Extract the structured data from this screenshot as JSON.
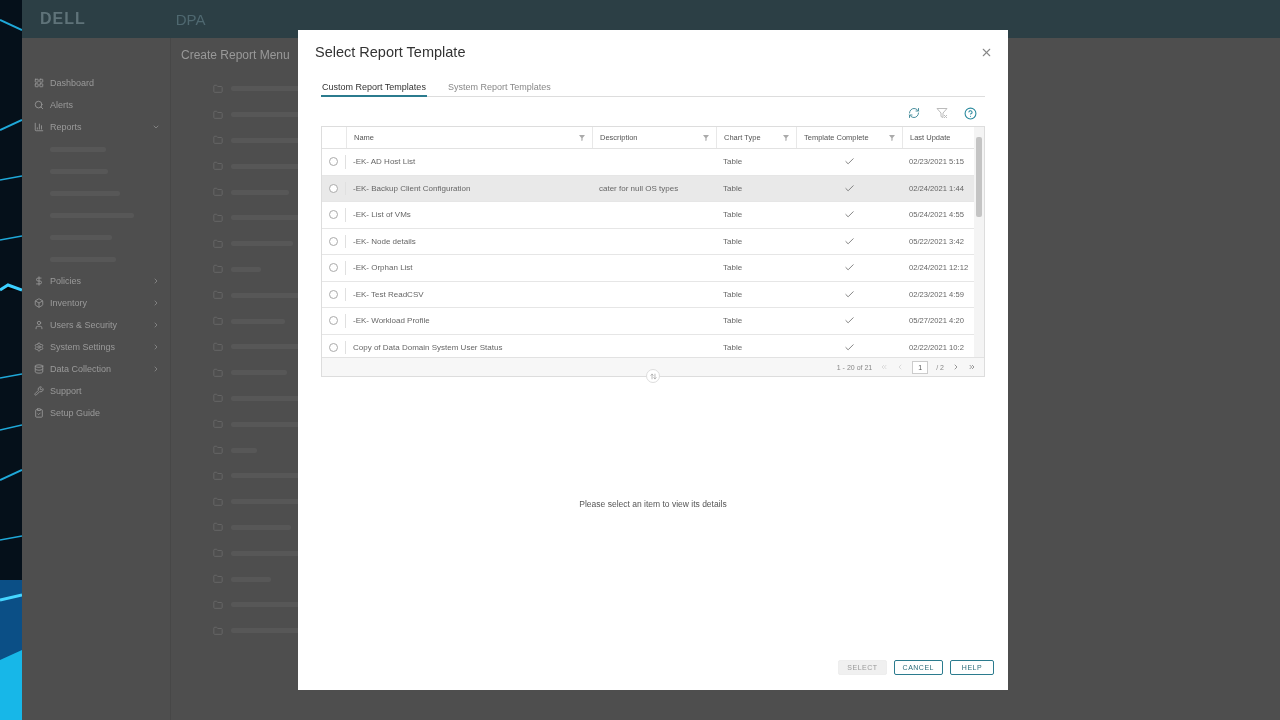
{
  "app": {
    "logo": "DELL",
    "product": "DPA",
    "page_title": "Create Report Menu",
    "nav": [
      {
        "label": "Dashboard",
        "chevron": false
      },
      {
        "label": "Alerts",
        "chevron": false
      },
      {
        "label": "Reports",
        "chevron": true
      },
      {
        "label": "Policies",
        "chevron": true
      },
      {
        "label": "Inventory",
        "chevron": true
      },
      {
        "label": "Users & Security",
        "chevron": true
      },
      {
        "label": "System Settings",
        "chevron": true
      },
      {
        "label": "Data Collection",
        "chevron": true
      },
      {
        "label": "Support",
        "chevron": false
      },
      {
        "label": "Setup Guide",
        "chevron": false
      }
    ]
  },
  "dialog": {
    "title": "Select Report Template",
    "tabs": [
      {
        "label": "Custom Report Templates",
        "selected": true
      },
      {
        "label": "System Report Templates",
        "selected": false
      }
    ],
    "table": {
      "columns": [
        "Name",
        "Description",
        "Chart Type",
        "Template Complete",
        "Last Update"
      ],
      "rows": [
        {
          "name": "-EK- AD Host List",
          "description": "",
          "chart_type": "Table",
          "complete": true,
          "last_update": "02/23/2021 5:15",
          "selected": false,
          "hovered": false
        },
        {
          "name": "-EK- Backup Client Configuration",
          "description": "cater for null OS types",
          "chart_type": "Table",
          "complete": true,
          "last_update": "02/24/2021 1:44",
          "selected": false,
          "hovered": true
        },
        {
          "name": "-EK- List of VMs",
          "description": "",
          "chart_type": "Table",
          "complete": true,
          "last_update": "05/24/2021 4:55",
          "selected": false,
          "hovered": false
        },
        {
          "name": "-EK- Node details",
          "description": "",
          "chart_type": "Table",
          "complete": true,
          "last_update": "05/22/2021 3:42",
          "selected": false,
          "hovered": false
        },
        {
          "name": "-EK- Orphan List",
          "description": "",
          "chart_type": "Table",
          "complete": true,
          "last_update": "02/24/2021 12:12",
          "selected": false,
          "hovered": false
        },
        {
          "name": "-EK- Test ReadCSV",
          "description": "",
          "chart_type": "Table",
          "complete": true,
          "last_update": "02/23/2021 4:59",
          "selected": false,
          "hovered": false
        },
        {
          "name": "-EK- Workload Profile",
          "description": "",
          "chart_type": "Table",
          "complete": true,
          "last_update": "05/27/2021 4:20",
          "selected": false,
          "hovered": false
        },
        {
          "name": "Copy of Data Domain System User Status",
          "description": "",
          "chart_type": "Table",
          "complete": true,
          "last_update": "02/22/2021 10:2",
          "selected": false,
          "hovered": false
        }
      ],
      "range": "1 - 20 of 21",
      "page": "1",
      "pages": "/ 2"
    },
    "empty_message": "Please select an item to view its details",
    "buttons": [
      {
        "label": "SELECT",
        "disabled": true
      },
      {
        "label": "CANCEL",
        "disabled": false
      },
      {
        "label": "HELP",
        "disabled": false
      }
    ]
  }
}
